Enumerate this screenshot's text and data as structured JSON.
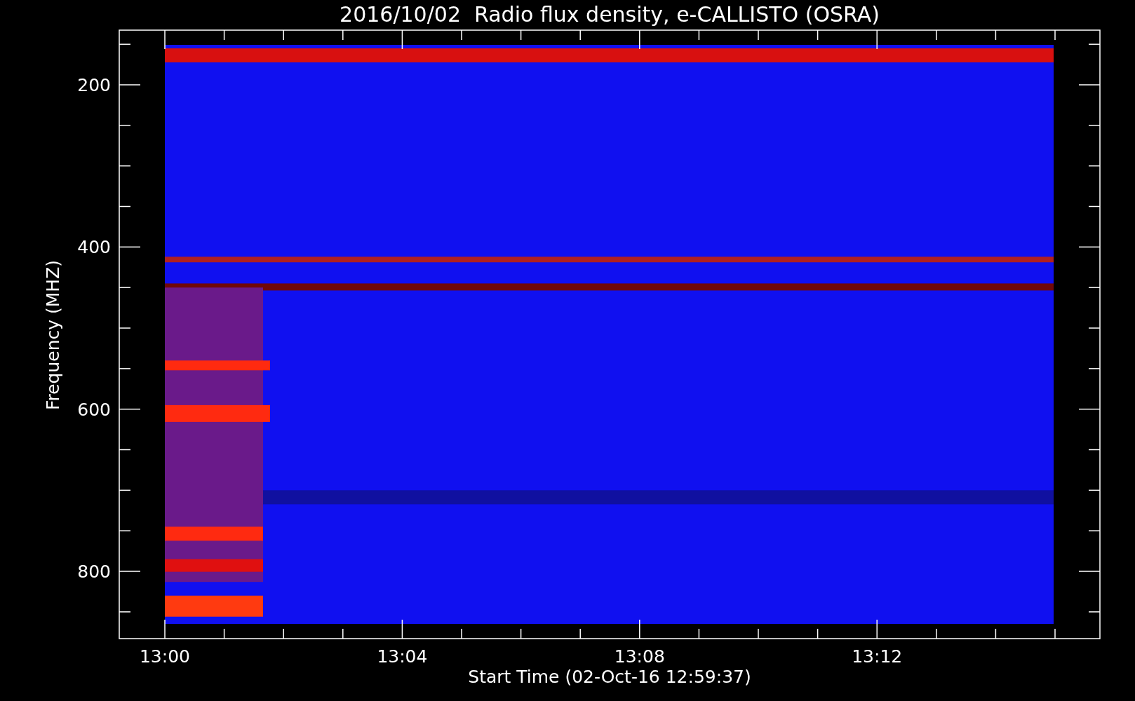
{
  "title": "2016/10/02  Radio flux density, e-CALLISTO (OSRA)",
  "y_axis": {
    "label": "Frequency (MHZ)",
    "ticks": [
      "200",
      "400",
      "600",
      "800"
    ]
  },
  "x_axis": {
    "label": "Start Time (02-Oct-16 12:59:37)",
    "ticks": [
      "13:00",
      "13:04",
      "13:08",
      "13:12"
    ]
  }
}
